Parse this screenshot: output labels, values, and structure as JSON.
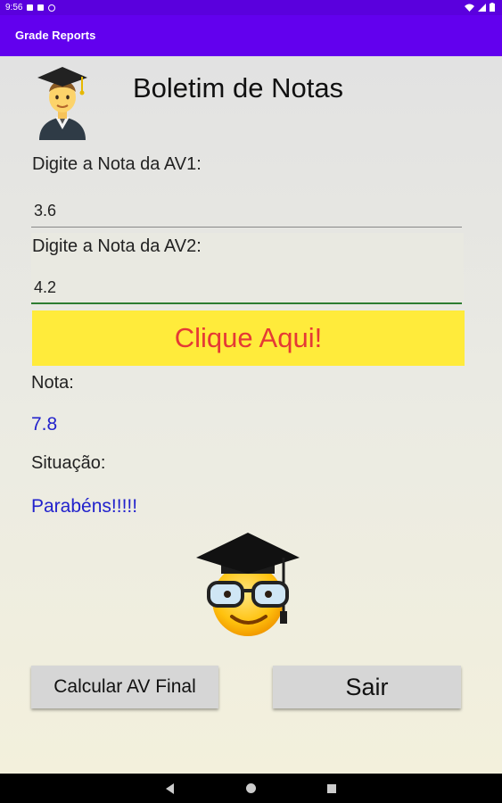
{
  "status": {
    "time": "9:56"
  },
  "app": {
    "title": "Grade Reports"
  },
  "header": {
    "title": "Boletim de Notas"
  },
  "av1": {
    "label": "Digite a Nota da AV1:",
    "value": "3.6"
  },
  "av2": {
    "label": "Digite a Nota da AV2:",
    "value": "4.2"
  },
  "actions": {
    "click_label": "Clique Aqui!",
    "final_label": "Calcular AV Final",
    "exit_label": "Sair"
  },
  "result": {
    "nota_label": "Nota:",
    "nota_value": "7.8",
    "situacao_label": "Situação:",
    "situacao_value": "Parabéns!!!!!"
  },
  "icons": {
    "student": "student-graduate-icon",
    "emoji": "nerd-graduate-emoji-icon"
  },
  "colors": {
    "app_bar": "#6200ee",
    "click_button": "#ffeb3b",
    "click_text": "#e53935",
    "result_text": "#2222cc"
  }
}
